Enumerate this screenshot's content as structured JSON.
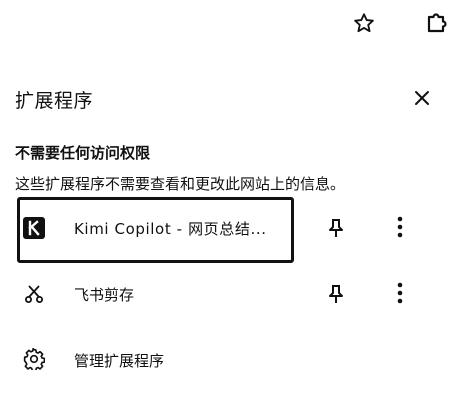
{
  "toolbar": {
    "bookmark_icon": "star-outline-icon",
    "extensions_icon": "puzzle-piece-icon"
  },
  "panel": {
    "title": "扩展程序",
    "close_icon": "close-icon"
  },
  "section": {
    "title": "不需要任何访问权限",
    "description": "这些扩展程序不需要查看和更改此网站上的信息。"
  },
  "extensions": [
    {
      "name": "Kimi Copilot - 网页总结...",
      "icon": "kimi-k-logo-icon",
      "pin_icon": "pin-icon",
      "menu_icon": "more-vertical-icon",
      "focused": true
    },
    {
      "name": "飞书剪存",
      "icon": "scissors-icon",
      "pin_icon": "pin-icon",
      "menu_icon": "more-vertical-icon",
      "focused": false
    }
  ],
  "manage": {
    "label": "管理扩展程序",
    "icon": "gear-icon"
  }
}
